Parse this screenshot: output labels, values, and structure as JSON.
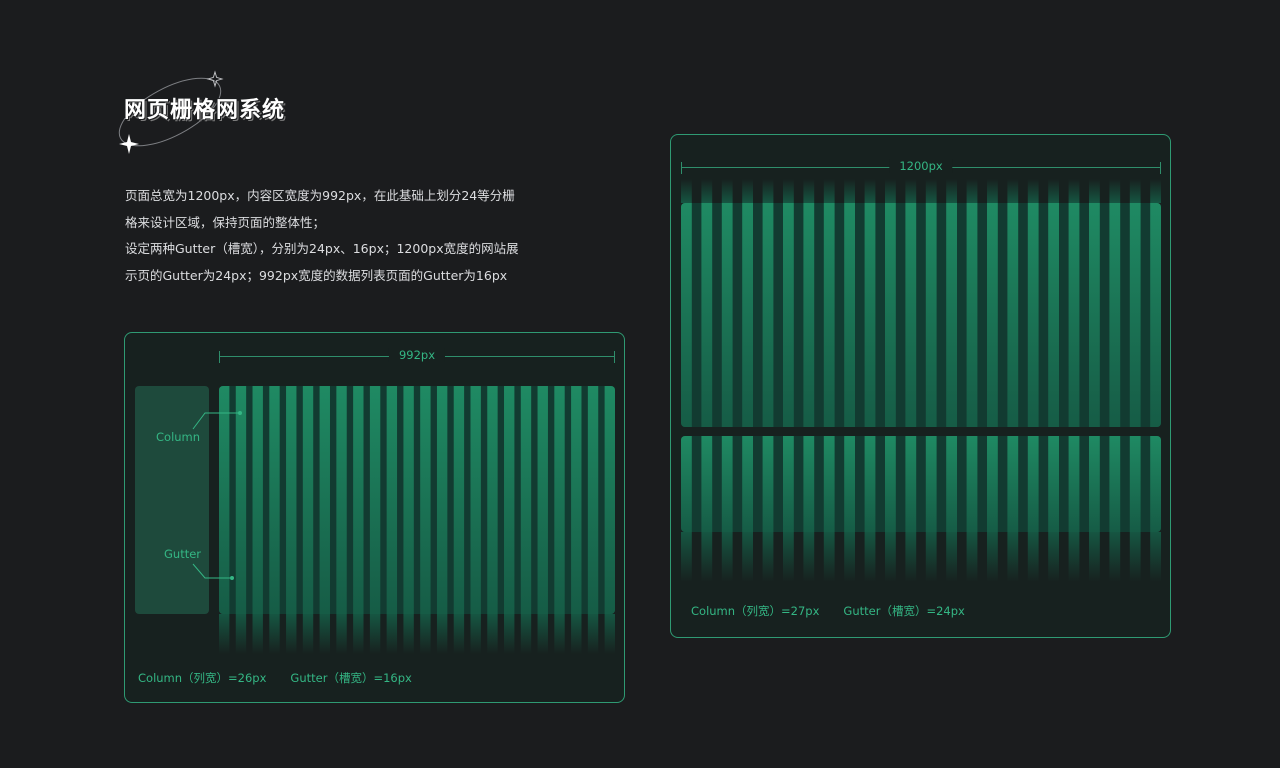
{
  "title": "网页栅格网系统",
  "description": [
    "页面总宽为1200px，内容区宽度为992px，在此基础上划分24等分栅",
    "格来设计区域，保持页面的整体性；",
    "设定两种Gutter（槽宽），分别为24px、16px；1200px宽度的网站展",
    "示页的Gutter为24px；992px宽度的数据列表页面的Gutter为16px"
  ],
  "small_grid": {
    "width_label": "992px",
    "column_label": "Column",
    "gutter_label": "Gutter",
    "footer_column": "Column（列宽）=26px",
    "footer_gutter": "Gutter（槽宽）=16px",
    "columns": 24
  },
  "large_grid": {
    "width_label": "1200px",
    "footer_column": "Column（列宽）=27px",
    "footer_gutter": "Gutter（槽宽）=24px",
    "columns": 24
  },
  "colors": {
    "accent": "#34b684",
    "border": "#2f9a73",
    "column_top": "#1f8a63",
    "column_bottom": "#165c46",
    "gutter": "#123b31",
    "background": "#1b1c1e"
  }
}
